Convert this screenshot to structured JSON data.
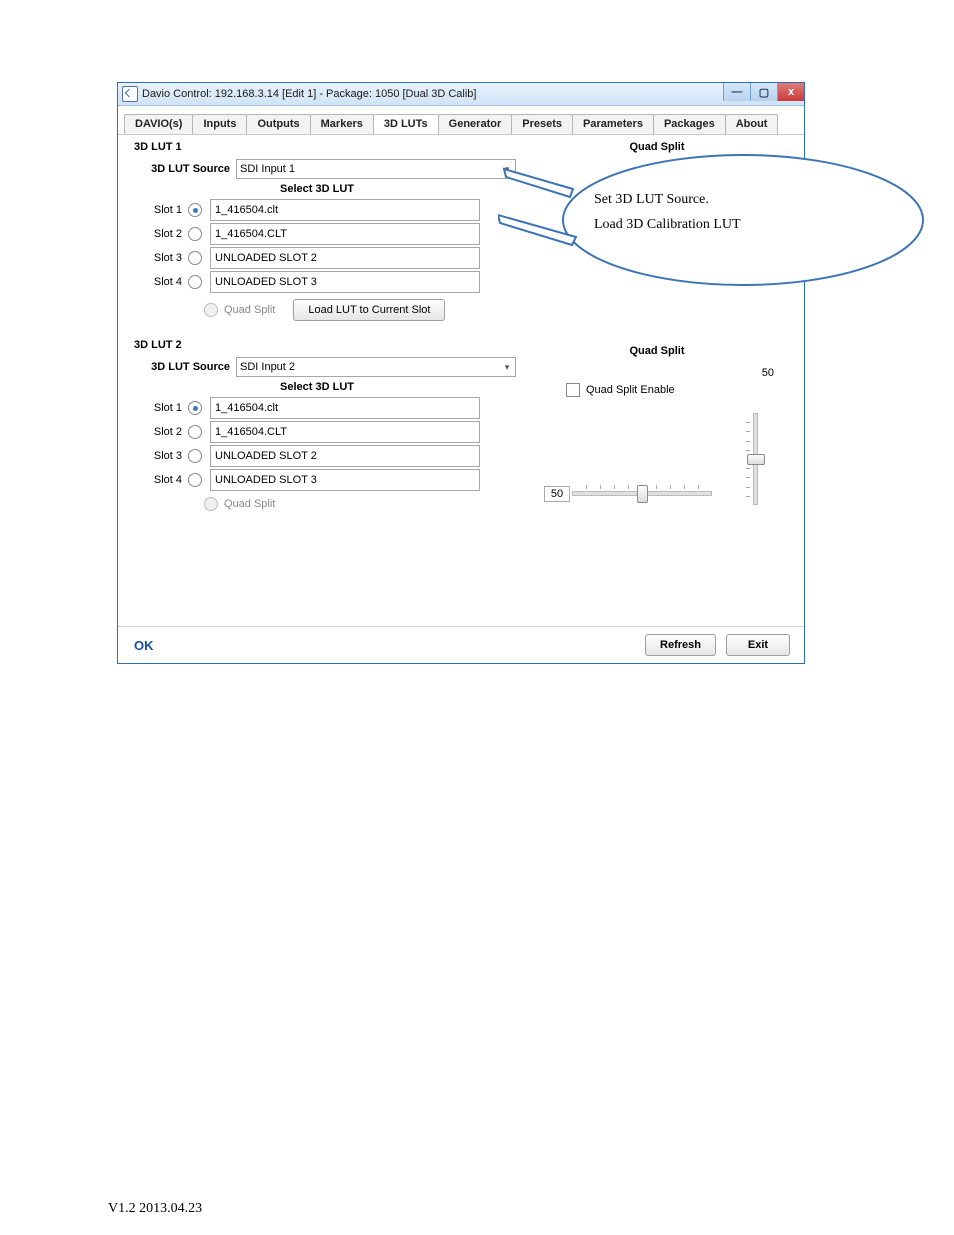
{
  "window": {
    "title": "Davio Control:  192.168.3.14  [Edit 1]  -  Package: 1050 [Dual 3D Calib]",
    "buttons": {
      "min": "—",
      "max": "▢",
      "close": "x"
    }
  },
  "tabs": [
    "DAVIO(s)",
    "Inputs",
    "Outputs",
    "Markers",
    "3D LUTs",
    "Generator",
    "Presets",
    "Parameters",
    "Packages",
    "About"
  ],
  "active_tab_index": 4,
  "lut1": {
    "title": "3D LUT 1",
    "source_label": "3D LUT Source",
    "source_value": "SDI Input 1",
    "select_label": "Select 3D LUT",
    "slots": [
      {
        "label": "Slot 1",
        "value": "1_416504.clt",
        "selected": true
      },
      {
        "label": "Slot 2",
        "value": "1_416504.CLT",
        "selected": false
      },
      {
        "label": "Slot 3",
        "value": "UNLOADED SLOT 2",
        "selected": false
      },
      {
        "label": "Slot 4",
        "value": "UNLOADED SLOT 3",
        "selected": false
      }
    ],
    "quad_split_option": "Quad Split",
    "load_button": "Load LUT to Current Slot",
    "quad_title": "Quad Split"
  },
  "lut2": {
    "title": "3D LUT 2",
    "source_label": "3D LUT Source",
    "source_value": "SDI Input 2",
    "select_label": "Select 3D LUT",
    "slots": [
      {
        "label": "Slot 1",
        "value": "1_416504.clt",
        "selected": true
      },
      {
        "label": "Slot 2",
        "value": "1_416504.CLT",
        "selected": false
      },
      {
        "label": "Slot 3",
        "value": "UNLOADED SLOT 2",
        "selected": false
      },
      {
        "label": "Slot 4",
        "value": "UNLOADED SLOT 3",
        "selected": false
      }
    ],
    "quad_split_option": "Quad Split",
    "quad_title": "Quad Split",
    "quad_enable_label": "Quad Split Enable",
    "quad_h_value": "50",
    "quad_v_value": "50"
  },
  "callout": {
    "line1": "Set 3D LUT Source.",
    "line2": "Load 3D Calibration LUT"
  },
  "bottom": {
    "ok": "OK",
    "refresh": "Refresh",
    "exit": "Exit"
  },
  "footer": "V1.2 2013.04.23"
}
